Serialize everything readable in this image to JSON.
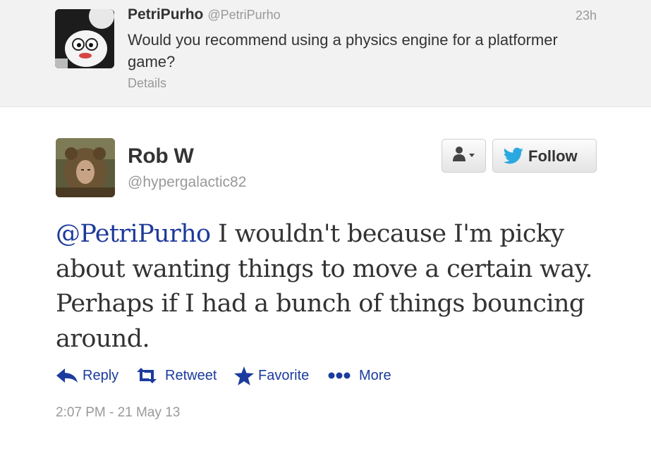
{
  "parent_tweet": {
    "display_name": "PetriPurho",
    "handle": "@PetriPurho",
    "time": "23h",
    "text": "Would you recommend using a physics engine for a platformer game?",
    "details_label": "Details"
  },
  "tweet": {
    "display_name": "Rob W",
    "handle": "@hypergalactic82",
    "mention": "@PetriPurho",
    "text": " I wouldn't because I'm picky about wanting things to move a certain way. Perhaps if I had a bunch of things bouncing around.",
    "timestamp": "2:07 PM - 21 May 13"
  },
  "header_buttons": {
    "follow_label": "Follow",
    "user_dropdown_icon": "person-dropdown-icon"
  },
  "actions": {
    "reply_label": "Reply",
    "retweet_label": "Retweet",
    "favorite_label": "Favorite",
    "more_label": "More"
  },
  "colors": {
    "link": "#1b3b9e",
    "twitter_blue": "#2aa9e0",
    "muted": "#999999",
    "text": "#333333",
    "parent_bg": "#f2f2f2"
  }
}
